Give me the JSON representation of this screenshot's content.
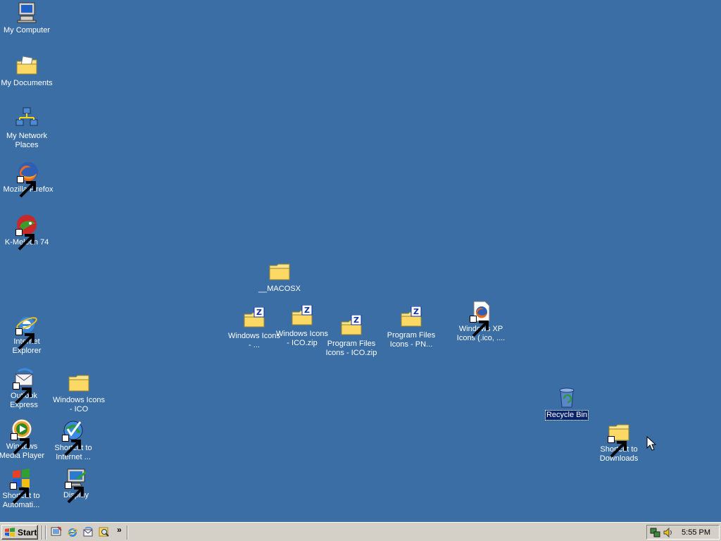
{
  "desktop": {
    "background_color": "#3a6ea5",
    "icons": {
      "my_computer": {
        "label": "My Computer",
        "icon": "computer-icon"
      },
      "my_documents": {
        "label": "My Documents",
        "icon": "documents-folder-icon"
      },
      "my_network_places": {
        "label": "My Network Places",
        "icon": "network-icon"
      },
      "mozilla_firefox": {
        "label": "Mozilla Firefox",
        "icon": "firefox-icon"
      },
      "k_meleon": {
        "label": "K-Meleon 74",
        "icon": "k-meleon-icon"
      },
      "internet_explorer": {
        "label": "Internet Explorer",
        "icon": "internet-explorer-icon"
      },
      "outlook_express": {
        "label": "Outlook Express",
        "icon": "outlook-express-icon"
      },
      "windows_icons_ico": {
        "label": "Windows Icons - ICO",
        "icon": "folder-icon"
      },
      "windows_media_player": {
        "label": "Windows Media Player",
        "icon": "media-player-icon"
      },
      "shortcut_internet": {
        "label": "Shortcut to Internet ...",
        "icon": "internet-connection-icon"
      },
      "shortcut_automatic": {
        "label": "Shortcut to Automati...",
        "icon": "windows-update-icon"
      },
      "display": {
        "label": "Display",
        "icon": "display-properties-icon"
      },
      "macosx": {
        "label": "__MACOSX",
        "icon": "folder-icon"
      },
      "windows_icons_zip1": {
        "label": "Windows Icons - ...",
        "icon": "zip-folder-icon"
      },
      "windows_icons_zip2": {
        "label": "Windows Icons - ICO.zip",
        "icon": "zip-folder-icon"
      },
      "program_files_icons_ico": {
        "label": "Program Files Icons - ICO.zip",
        "icon": "zip-folder-icon"
      },
      "program_files_icons_pn": {
        "label": "Program Files Icons - PN...",
        "icon": "zip-folder-icon"
      },
      "windows_xp_icons": {
        "label": "Windows XP Icons (.ico, ....",
        "icon": "firefox-document-icon"
      },
      "recycle_bin": {
        "label": "Recycle Bin",
        "icon": "recycle-bin-icon",
        "selected": true
      },
      "shortcut_downloads": {
        "label": "Shortcut to Downloads",
        "icon": "folder-icon"
      }
    }
  },
  "taskbar": {
    "start_label": "Start",
    "quick_launch": [
      "show-desktop-icon",
      "internet-explorer-icon",
      "outlook-express-icon",
      "search-icon"
    ],
    "overflow_label": "»",
    "tray_icons": [
      "network-tray-icon",
      "volume-tray-icon"
    ],
    "clock": "5:55 PM",
    "background_color": "#d4d0c8"
  }
}
